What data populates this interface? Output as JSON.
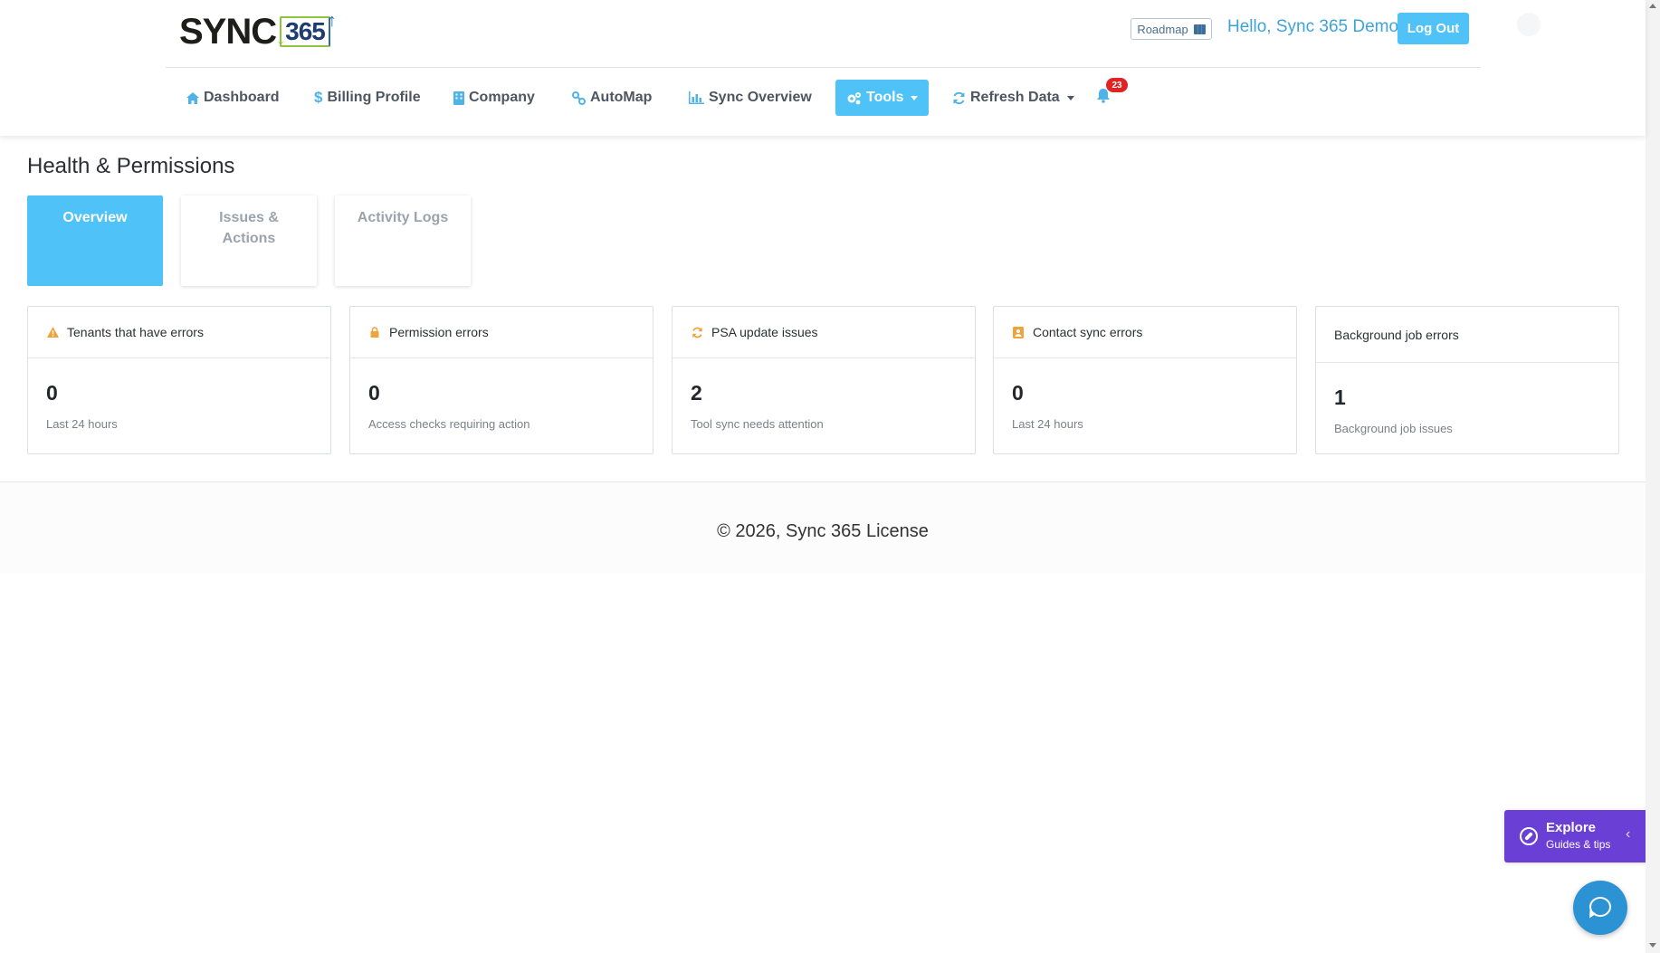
{
  "brand": {
    "logo_text": "SYNC",
    "logo_box": "365"
  },
  "header": {
    "roadmap_label": "Roadmap",
    "greeting": "Hello, Sync 365 Demo",
    "logout_label": "Log Out",
    "notification_count": "23"
  },
  "nav": {
    "items": [
      {
        "label": "Dashboard",
        "icon": "home-icon"
      },
      {
        "label": "Billing Profile",
        "icon": "dollar-icon"
      },
      {
        "label": "Company",
        "icon": "building-icon"
      },
      {
        "label": "AutoMap",
        "icon": "link-icon"
      },
      {
        "label": "Sync Overview",
        "icon": "bar-chart-icon"
      },
      {
        "label": "Tools",
        "icon": "gears-icon",
        "active": true
      },
      {
        "label": "Refresh Data",
        "icon": "refresh-icon"
      }
    ]
  },
  "page": {
    "title": "Health & Permissions"
  },
  "tabs": [
    {
      "label": "Overview",
      "active": true
    },
    {
      "label": "Issues & Actions"
    },
    {
      "label": "Activity Logs"
    }
  ],
  "cards": [
    {
      "title": "Tenants that have errors",
      "icon": "warning-icon",
      "value": "0",
      "subtitle": "Last 24 hours"
    },
    {
      "title": "Permission errors",
      "icon": "lock-icon",
      "value": "0",
      "subtitle": "Access checks requiring action"
    },
    {
      "title": "PSA update issues",
      "icon": "sync-icon",
      "value": "2",
      "subtitle": "Tool sync needs attention"
    },
    {
      "title": "Contact sync errors",
      "icon": "contact-icon",
      "value": "0",
      "subtitle": "Last 24 hours"
    },
    {
      "title": "Background job errors",
      "icon": "",
      "value": "1",
      "subtitle": "Background job issues"
    }
  ],
  "footer": {
    "text": "© 2026, Sync 365 License"
  },
  "explore": {
    "title": "Explore",
    "subtitle": "Guides & tips"
  },
  "colors": {
    "accent": "#4fc3f7",
    "link": "#3ea3d9",
    "badge": "#e02424",
    "explore": "#6a3fd6",
    "chat": "#2b93d3",
    "warning": "#f0a23b"
  }
}
